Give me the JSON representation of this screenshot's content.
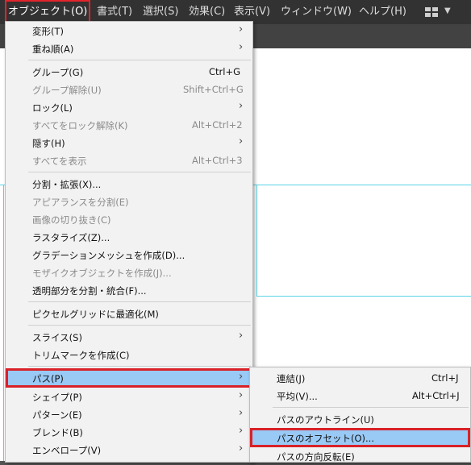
{
  "menubar": {
    "items": [
      "オブジェクト(O)",
      "書式(T)",
      "選択(S)",
      "効果(C)",
      "表示(V)",
      "ウィンドウ(W)",
      "ヘルプ(H)"
    ],
    "icons": [
      "workspace-grid-icon",
      "chevron-down-icon"
    ]
  },
  "object_menu": [
    {
      "label": "変形(T)",
      "submenu": true
    },
    {
      "label": "重ね順(A)",
      "submenu": true
    },
    {
      "label": "グループ(G)",
      "shortcut": "Ctrl+G"
    },
    {
      "label": "グループ解除(U)",
      "shortcut": "Shift+Ctrl+G",
      "disabled": true
    },
    {
      "label": "ロック(L)",
      "submenu": true
    },
    {
      "label": "すべてをロック解除(K)",
      "shortcut": "Alt+Ctrl+2",
      "disabled": true
    },
    {
      "label": "隠す(H)",
      "submenu": true
    },
    {
      "label": "すべてを表示",
      "shortcut": "Alt+Ctrl+3",
      "disabled": true
    },
    {
      "label": "分割・拡張(X)..."
    },
    {
      "label": "アピアランスを分割(E)",
      "disabled": true
    },
    {
      "label": "画像の切り抜き(C)",
      "disabled": true
    },
    {
      "label": "ラスタライズ(Z)..."
    },
    {
      "label": "グラデーションメッシュを作成(D)..."
    },
    {
      "label": "モザイクオブジェクトを作成(J)...",
      "disabled": true
    },
    {
      "label": "透明部分を分割・統合(F)..."
    },
    {
      "label": "ピクセルグリッドに最適化(M)"
    },
    {
      "label": "スライス(S)",
      "submenu": true
    },
    {
      "label": "トリムマークを作成(C)"
    },
    {
      "label": "パス(P)",
      "submenu": true,
      "highlighted": true
    },
    {
      "label": "シェイプ(P)",
      "submenu": true
    },
    {
      "label": "パターン(E)",
      "submenu": true
    },
    {
      "label": "ブレンド(B)",
      "submenu": true
    },
    {
      "label": "エンベロープ(V)",
      "submenu": true
    }
  ],
  "path_menu": [
    {
      "label": "連結(J)",
      "shortcut": "Ctrl+J"
    },
    {
      "label": "平均(V)...",
      "shortcut": "Alt+Ctrl+J"
    },
    {
      "label": "パスのアウトライン(U)"
    },
    {
      "label": "パスのオフセット(O)...",
      "highlighted": true
    },
    {
      "label": "パスの方向反転(E)"
    }
  ],
  "colors": {
    "menubar_bg": "#323232",
    "menu_bg": "#f2f2f2",
    "highlight": "#99c9f5",
    "annotation_red": "#e3242b",
    "guide_cyan": "#5ad4e6"
  }
}
